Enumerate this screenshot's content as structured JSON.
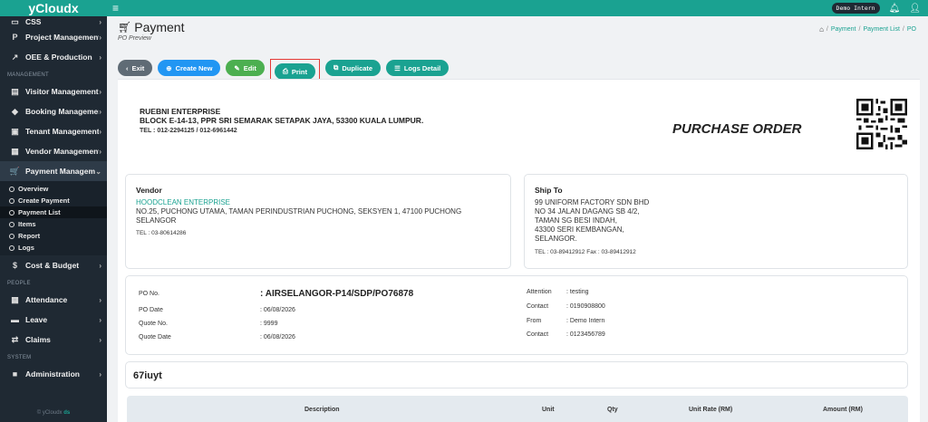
{
  "app": {
    "brand": "yCloudx",
    "user": "Demo Intern"
  },
  "sidebar": {
    "top_items": [
      {
        "label": "CSS",
        "icon": "monitor-icon"
      },
      {
        "label": "Project Management",
        "icon": "p-icon"
      },
      {
        "label": "OEE & Production",
        "icon": "chart-line-icon"
      }
    ],
    "section_management": "MANAGEMENT",
    "management_items": [
      {
        "label": "Visitor Management",
        "icon": "id-card-icon"
      },
      {
        "label": "Booking Management",
        "icon": "diamond-icon"
      },
      {
        "label": "Tenant Management",
        "icon": "building-icon"
      },
      {
        "label": "Vendor Management",
        "icon": "vendor-icon"
      },
      {
        "label": "Payment Management",
        "icon": "cart-icon"
      }
    ],
    "payment_subitems": [
      "Overview",
      "Create Payment",
      "Payment List",
      "Items",
      "Report",
      "Logs"
    ],
    "cost_item": {
      "label": "Cost & Budget",
      "icon": "dollar-icon"
    },
    "section_people": "PEOPLE",
    "people_items": [
      {
        "label": "Attendance",
        "icon": "calendar-icon"
      },
      {
        "label": "Leave",
        "icon": "car-icon"
      },
      {
        "label": "Claims",
        "icon": "arrows-icon"
      }
    ],
    "section_system": "SYSTEM",
    "system_items": [
      {
        "label": "Administration",
        "icon": "admin-icon"
      }
    ],
    "footer_prefix": "© yCloudx",
    "footer_suffix": "ds"
  },
  "header": {
    "title": "Payment",
    "subtitle": "PO Preview",
    "breadcrumb": [
      "Payment",
      "Payment List",
      "PO"
    ]
  },
  "toolbar": {
    "exit": "Exit",
    "create": "Create New",
    "edit": "Edit",
    "print": "Print",
    "duplicate": "Duplicate",
    "logs": "Logs Detail"
  },
  "company": {
    "name": "RUEBNI ENTERPRISE",
    "address": "BLOCK E-14-13, PPR SRI SEMARAK SETAPAK JAYA, 53300 KUALA LUMPUR.",
    "tel": "TEL : 012-2294125 / 012-6961442",
    "doc_title": "PURCHASE ORDER"
  },
  "vendor": {
    "heading": "Vendor",
    "name": "HOODCLEAN ENTERPRISE",
    "address": "NO.25, PUCHONG UTAMA, TAMAN PERINDUSTRIAN PUCHONG, SEKSYEN 1, 47100 PUCHONG SELANGOR",
    "tel": "TEL : 03-80614286"
  },
  "ship_to": {
    "heading": "Ship To",
    "lines": [
      "99 UNIFORM FACTORY SDN BHD",
      "NO 34 JALAN DAGANG SB 4/2,",
      "TAMAN SG BESI INDAH,",
      "43300 SERI KEMBANGAN,",
      "SELANGOR."
    ],
    "tel": "TEL : 03-89412912    Fax : 03-89412912"
  },
  "po_info": {
    "po_no_label": "PO No.",
    "po_no": ": AIRSELANGOR-P14/SDP/PO76878",
    "po_date_label": "PO Date",
    "po_date": ": 06/08/2026",
    "quote_no_label": "Quote No.",
    "quote_no": ": 9999",
    "quote_date_label": "Quote Date",
    "quote_date": ": 06/08/2026",
    "attention_label": "Attention",
    "attention": ": testing",
    "contact_label": "Contact",
    "contact1": ": 0190908800",
    "from_label": "From",
    "from": ": Demo Intern",
    "contact2": ": 0123456789"
  },
  "subject": "67iuyt",
  "table": {
    "headers": [
      "Description",
      "Unit",
      "Qty",
      "Unit Rate (RM)",
      "Amount (RM)"
    ]
  },
  "colors": {
    "accent": "#1aa291",
    "sidebar": "#1f2933",
    "highlight_box": "#e53935"
  }
}
